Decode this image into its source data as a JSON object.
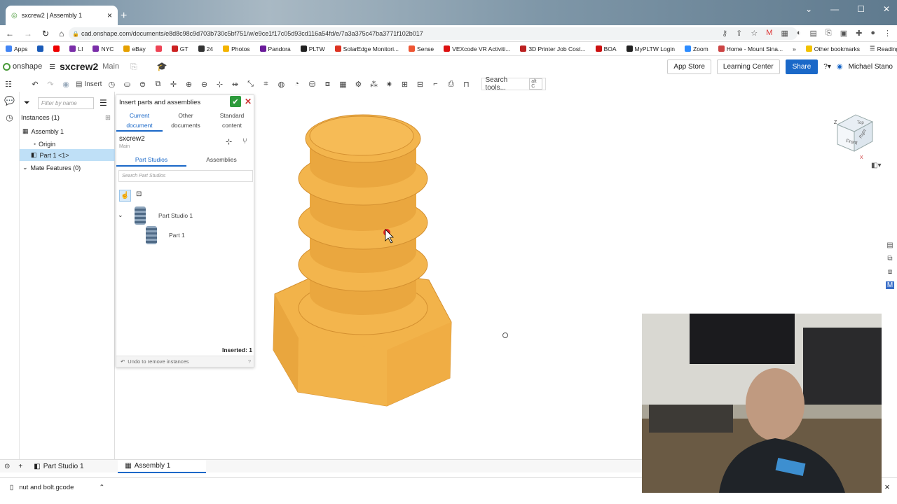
{
  "browser": {
    "tab_title": "sxcrew2 | Assembly 1",
    "url": "cad.onshape.com/documents/e8d8c98c9d703b730c5bf751/w/e9ce1f17c05d93cd116a54fd/e/7a3a375c47ba3771f102b017",
    "bookmarks": [
      "Apps",
      "LI",
      "NYC",
      "eBay",
      "GT",
      "24",
      "Photos",
      "Pandora",
      "PLTW",
      "SolarEdge Monitori...",
      "Sense",
      "VEXcode VR Activiti...",
      "3D Printer Job Cost...",
      "BOA",
      "MyPLTW Login",
      "Zoom",
      "Home - Mount Sina..."
    ],
    "other_bookmarks": "Other bookmarks",
    "reading_list": "Reading list"
  },
  "header": {
    "logo_text": "onshape",
    "doc_name": "sxcrew2",
    "branch": "Main",
    "app_store": "App Store",
    "learning_center": "Learning Center",
    "share": "Share",
    "user": "Michael Stano"
  },
  "toolbar": {
    "insert_label": "Insert",
    "search_tools": "Search tools...",
    "search_kbd": "alt C"
  },
  "instances": {
    "filter_placeholder": "Filter by name",
    "header": "Instances (1)",
    "assembly": "Assembly 1",
    "origin": "Origin",
    "part": "Part 1 <1>",
    "mate_features": "Mate Features (0)"
  },
  "dialog": {
    "title": "Insert parts and assemblies",
    "tab_current_1": "Current",
    "tab_current_2": "document",
    "tab_other_1": "Other",
    "tab_other_2": "documents",
    "tab_std_1": "Standard",
    "tab_std_2": "content",
    "doc_name": "sxcrew2",
    "doc_branch": "Main",
    "part_studios_tab": "Part Studios",
    "assemblies_tab": "Assemblies",
    "search_placeholder": "Search Part Studios",
    "part_studio": "Part Studio 1",
    "part": "Part 1",
    "inserted": "Inserted: 1",
    "undo": "Undo to remove instances"
  },
  "bottom_tabs": {
    "part_studio": "Part Studio 1",
    "assembly": "Assembly 1"
  },
  "download": {
    "filename": "nut and bolt.gcode"
  },
  "viewcube": {
    "top": "Top",
    "front": "Front",
    "right": "Right",
    "z": "Z",
    "x": "X"
  },
  "colors": {
    "part_fill": "#f2b34a",
    "accent": "#1a68c8",
    "ok": "#2d9b3c"
  }
}
